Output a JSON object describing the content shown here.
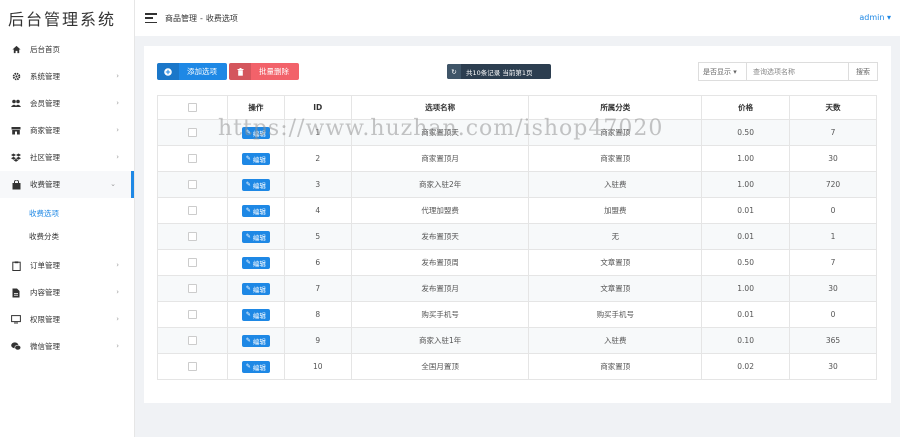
{
  "app": {
    "logo": "后台管理系统"
  },
  "sidebar": {
    "items": [
      {
        "label": "后台首页",
        "icon": "home-icon"
      },
      {
        "label": "系统管理",
        "icon": "gear-icon"
      },
      {
        "label": "会员管理",
        "icon": "users-icon"
      },
      {
        "label": "商家管理",
        "icon": "store-icon"
      },
      {
        "label": "社区管理",
        "icon": "dropbox-icon"
      },
      {
        "label": "收费管理",
        "icon": "bag-icon"
      },
      {
        "label": "订单管理",
        "icon": "clipboard-icon"
      },
      {
        "label": "内容管理",
        "icon": "file-icon"
      },
      {
        "label": "权限管理",
        "icon": "monitor-icon"
      },
      {
        "label": "微信管理",
        "icon": "wechat-icon"
      }
    ],
    "subitems": [
      {
        "label": "收费选项"
      },
      {
        "label": "收费分类"
      }
    ]
  },
  "header": {
    "breadcrumb": [
      "商品管理",
      "收费选项"
    ],
    "separator": "-",
    "user": "admin"
  },
  "toolbar": {
    "add_label": "添加选项",
    "delete_label": "批量删除",
    "info_label": "共10条记录 当前第1页",
    "filter_select": "是否显示",
    "search_placeholder": "查询选项名称",
    "search_button": "搜索"
  },
  "table": {
    "headers": [
      "",
      "操作",
      "ID",
      "选项名称",
      "所属分类",
      "价格",
      "天数"
    ],
    "edit_label": "编辑",
    "rows": [
      {
        "id": "1",
        "name": "商家置顶天",
        "category": "商家置顶",
        "price": "0.50",
        "days": "7"
      },
      {
        "id": "2",
        "name": "商家置顶月",
        "category": "商家置顶",
        "price": "1.00",
        "days": "30"
      },
      {
        "id": "3",
        "name": "商家入驻2年",
        "category": "入驻费",
        "price": "1.00",
        "days": "720"
      },
      {
        "id": "4",
        "name": "代理加盟费",
        "category": "加盟费",
        "price": "0.01",
        "days": "0"
      },
      {
        "id": "5",
        "name": "发布置顶天",
        "category": "无",
        "price": "0.01",
        "days": "1"
      },
      {
        "id": "6",
        "name": "发布置顶周",
        "category": "文章置顶",
        "price": "0.50",
        "days": "7"
      },
      {
        "id": "7",
        "name": "发布置顶月",
        "category": "文章置顶",
        "price": "1.00",
        "days": "30"
      },
      {
        "id": "8",
        "name": "购买手机号",
        "category": "购买手机号",
        "price": "0.01",
        "days": "0"
      },
      {
        "id": "9",
        "name": "商家入驻1年",
        "category": "入驻费",
        "price": "0.10",
        "days": "365"
      },
      {
        "id": "10",
        "name": "全国月置顶",
        "category": "商家置顶",
        "price": "0.02",
        "days": "30"
      }
    ]
  },
  "watermark": "https://www.huzhan.com/ishop47020",
  "colors": {
    "primary": "#1e88e5",
    "danger": "#f2626a",
    "dark": "#2c3e50"
  }
}
